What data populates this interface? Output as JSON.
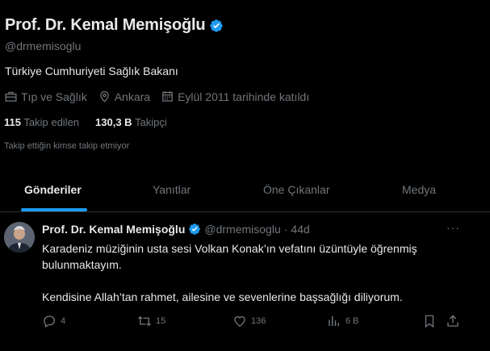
{
  "profile": {
    "display_name": "Prof. Dr. Kemal Memişoğlu",
    "handle": "@drmemisoglu",
    "bio": "Türkiye Cumhuriyeti Sağlık Bakanı",
    "category": "Tıp ve Sağlık",
    "location": "Ankara",
    "joined": "Eylül 2011 tarihinde katıldı",
    "following_count": "115",
    "following_label": "Takip edilen",
    "followers_count": "130,3 B",
    "followers_label": "Takipçi",
    "mutual_note": "Takip ettiğin kimse takip etmiyor"
  },
  "tabs": [
    {
      "label": "Gönderiler",
      "active": true
    },
    {
      "label": "Yanıtlar",
      "active": false
    },
    {
      "label": "Öne Çıkanlar",
      "active": false
    },
    {
      "label": "Medya",
      "active": false
    }
  ],
  "tweet": {
    "name": "Prof. Dr. Kemal Memişoğlu",
    "handle": "@drmemisoglu",
    "dot": "·",
    "time": "44d",
    "more": "···",
    "paragraph_1": "Karadeniz müziğinin usta sesi Volkan Konak’ın vefatını üzüntüyle öğrenmiş bulunmaktayım.",
    "paragraph_2": "Kendisine Allah’tan rahmet, ailesine ve sevenlerine başsağlığı diliyorum.",
    "replies": "4",
    "reposts": "15",
    "likes": "136",
    "views": "6 B"
  },
  "colors": {
    "background": "#000000",
    "text_primary": "#e7e9ea",
    "text_secondary": "#71767b",
    "accent": "#1d9bf0",
    "divider": "#2f3336"
  },
  "icons": [
    "verified-badge-icon",
    "briefcase-icon",
    "location-pin-icon",
    "calendar-icon",
    "reply-icon",
    "repost-icon",
    "like-icon",
    "views-icon",
    "bookmark-icon",
    "share-icon",
    "more-icon"
  ]
}
